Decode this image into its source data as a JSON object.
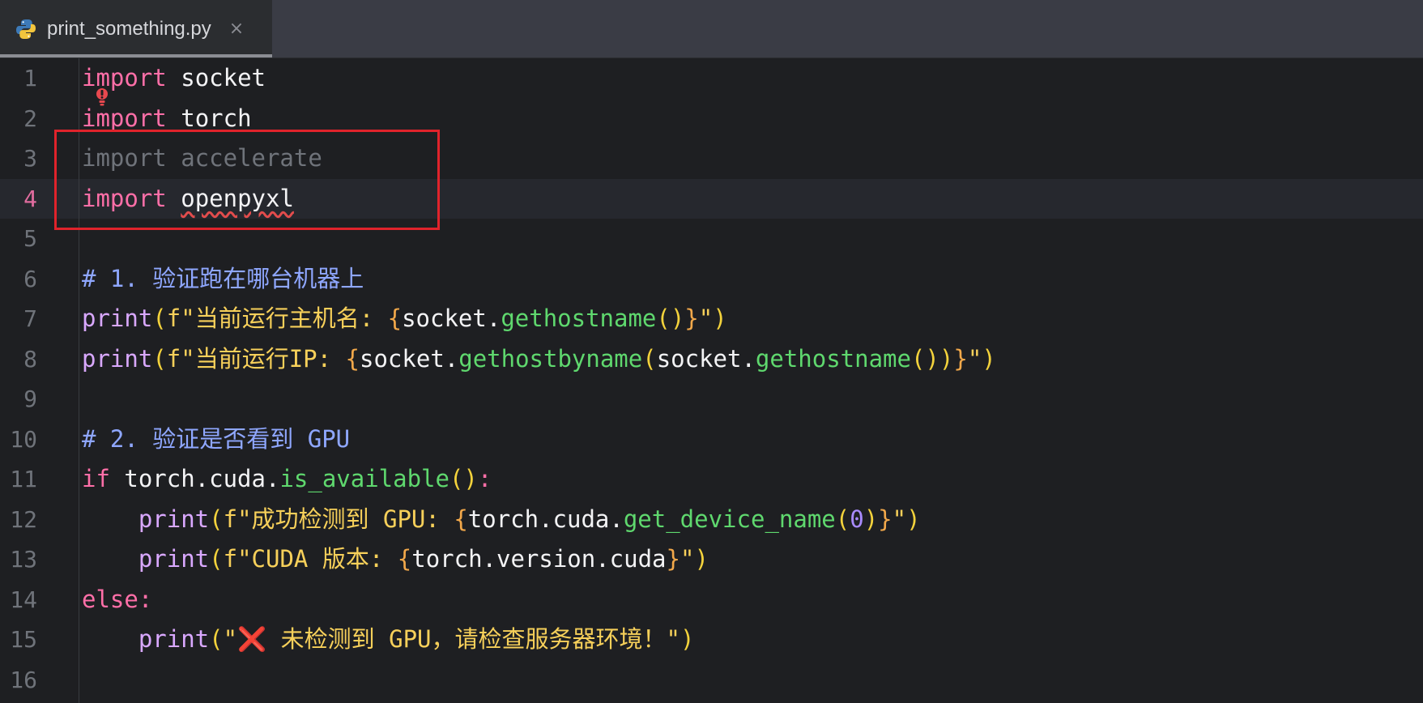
{
  "tab": {
    "filename": "print_something.py",
    "close": "×",
    "icon": "python-icon"
  },
  "current_line": 4,
  "lines": [
    {
      "n": "1",
      "tokens": [
        {
          "t": "import",
          "c": "kw"
        },
        {
          "t": " ",
          "c": "id"
        },
        {
          "t": "socket",
          "c": "id"
        }
      ]
    },
    {
      "n": "2",
      "tokens": [
        {
          "t": "import",
          "c": "kw"
        },
        {
          "t": " ",
          "c": "id"
        },
        {
          "t": "torch",
          "c": "id"
        }
      ]
    },
    {
      "n": "3",
      "tokens": [
        {
          "t": "import accelerate",
          "c": "dim"
        }
      ]
    },
    {
      "n": "4",
      "tokens": [
        {
          "t": "import",
          "c": "kw"
        },
        {
          "t": " ",
          "c": "id"
        },
        {
          "t": "openpyxl",
          "c": "id err"
        }
      ]
    },
    {
      "n": "5",
      "tokens": []
    },
    {
      "n": "6",
      "tokens": [
        {
          "t": "# 1. 验证跑在哪台机器上",
          "c": "cm"
        }
      ]
    },
    {
      "n": "7",
      "tokens": [
        {
          "t": "print",
          "c": "bi"
        },
        {
          "t": "(",
          "c": "par"
        },
        {
          "t": "f\"当前运行主机名: ",
          "c": "str"
        },
        {
          "t": "{",
          "c": "brace"
        },
        {
          "t": "socket.",
          "c": "id"
        },
        {
          "t": "gethostname",
          "c": "fn"
        },
        {
          "t": "()",
          "c": "par"
        },
        {
          "t": "}",
          "c": "brace"
        },
        {
          "t": "\"",
          "c": "str"
        },
        {
          "t": ")",
          "c": "par"
        }
      ]
    },
    {
      "n": "8",
      "tokens": [
        {
          "t": "print",
          "c": "bi"
        },
        {
          "t": "(",
          "c": "par"
        },
        {
          "t": "f\"当前运行IP: ",
          "c": "str"
        },
        {
          "t": "{",
          "c": "brace"
        },
        {
          "t": "socket.",
          "c": "id"
        },
        {
          "t": "gethostbyname",
          "c": "fn"
        },
        {
          "t": "(",
          "c": "par"
        },
        {
          "t": "socket.",
          "c": "id"
        },
        {
          "t": "gethostname",
          "c": "fn"
        },
        {
          "t": "())",
          "c": "par"
        },
        {
          "t": "}",
          "c": "brace"
        },
        {
          "t": "\"",
          "c": "str"
        },
        {
          "t": ")",
          "c": "par"
        }
      ]
    },
    {
      "n": "9",
      "tokens": []
    },
    {
      "n": "10",
      "tokens": [
        {
          "t": "# 2. 验证是否看到 GPU",
          "c": "cm"
        }
      ]
    },
    {
      "n": "11",
      "tokens": [
        {
          "t": "if",
          "c": "kw"
        },
        {
          "t": " torch.cuda.",
          "c": "id"
        },
        {
          "t": "is_available",
          "c": "fn"
        },
        {
          "t": "()",
          "c": "par"
        },
        {
          "t": ":",
          "c": "kw"
        }
      ]
    },
    {
      "n": "12",
      "tokens": [
        {
          "t": "    ",
          "c": "id"
        },
        {
          "t": "print",
          "c": "bi"
        },
        {
          "t": "(",
          "c": "par"
        },
        {
          "t": "f\"成功检测到 GPU: ",
          "c": "str"
        },
        {
          "t": "{",
          "c": "brace"
        },
        {
          "t": "torch.cuda.",
          "c": "id"
        },
        {
          "t": "get_device_name",
          "c": "fn"
        },
        {
          "t": "(",
          "c": "par"
        },
        {
          "t": "0",
          "c": "num"
        },
        {
          "t": ")",
          "c": "par"
        },
        {
          "t": "}",
          "c": "brace"
        },
        {
          "t": "\"",
          "c": "str"
        },
        {
          "t": ")",
          "c": "par"
        }
      ]
    },
    {
      "n": "13",
      "tokens": [
        {
          "t": "    ",
          "c": "id"
        },
        {
          "t": "print",
          "c": "bi"
        },
        {
          "t": "(",
          "c": "par"
        },
        {
          "t": "f\"CUDA 版本: ",
          "c": "str"
        },
        {
          "t": "{",
          "c": "brace"
        },
        {
          "t": "torch.version.cuda",
          "c": "id"
        },
        {
          "t": "}",
          "c": "brace"
        },
        {
          "t": "\"",
          "c": "str"
        },
        {
          "t": ")",
          "c": "par"
        }
      ]
    },
    {
      "n": "14",
      "tokens": [
        {
          "t": "else:",
          "c": "kw"
        }
      ]
    },
    {
      "n": "15",
      "tokens": [
        {
          "t": "    ",
          "c": "id"
        },
        {
          "t": "print",
          "c": "bi"
        },
        {
          "t": "(",
          "c": "par"
        },
        {
          "t": "\"",
          "c": "str"
        },
        {
          "t": "❌",
          "c": "redx"
        },
        {
          "t": " 未检测到 GPU，请检查服务器环境！\"",
          "c": "str"
        },
        {
          "t": ")",
          "c": "par"
        }
      ]
    },
    {
      "n": "16",
      "tokens": []
    }
  ],
  "annotations": {
    "lightbulb": "warning-bulb-icon",
    "box_color": "#e0232b"
  }
}
